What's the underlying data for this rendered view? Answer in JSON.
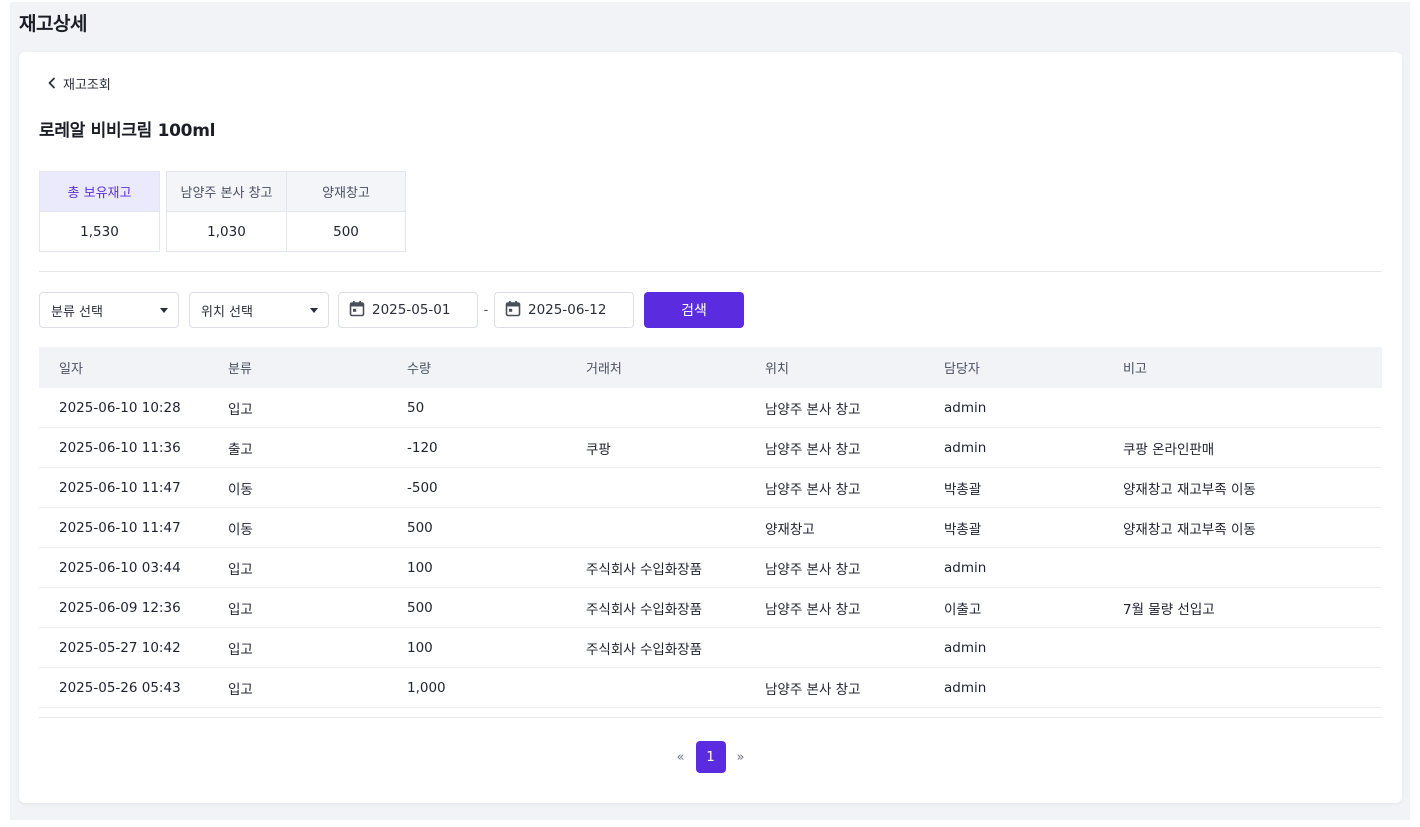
{
  "page": {
    "title": "재고상세"
  },
  "back": {
    "label": "재고조회"
  },
  "product": {
    "name": "로레알 비비크림 100ml"
  },
  "stock": {
    "total": {
      "label": "총 보유재고",
      "value": "1,530"
    },
    "locations": [
      {
        "label": "남양주 본사 창고",
        "value": "1,030"
      },
      {
        "label": "양재창고",
        "value": "500"
      }
    ]
  },
  "filters": {
    "category_placeholder": "분류 선택",
    "location_placeholder": "위치 선택",
    "date_from": "2025-05-01",
    "date_separator": "-",
    "date_to": "2025-06-12",
    "search_label": "검색"
  },
  "table": {
    "headers": [
      "일자",
      "분류",
      "수량",
      "거래처",
      "위치",
      "담당자",
      "비고"
    ],
    "rows": [
      [
        "2025-06-10 10:28",
        "입고",
        "50",
        "",
        "남양주 본사 창고",
        "admin",
        ""
      ],
      [
        "2025-06-10 11:36",
        "출고",
        "-120",
        "쿠팡",
        "남양주 본사 창고",
        "admin",
        "쿠팡 온라인판매"
      ],
      [
        "2025-06-10 11:47",
        "이동",
        "-500",
        "",
        "남양주 본사 창고",
        "박총괄",
        "양재창고 재고부족 이동"
      ],
      [
        "2025-06-10 11:47",
        "이동",
        "500",
        "",
        "양재창고",
        "박총괄",
        "양재창고 재고부족 이동"
      ],
      [
        "2025-06-10 03:44",
        "입고",
        "100",
        "주식회사 수입화장품",
        "남양주 본사 창고",
        "admin",
        ""
      ],
      [
        "2025-06-09 12:36",
        "입고",
        "500",
        "주식회사 수입화장품",
        "남양주 본사 창고",
        "이출고",
        "7월 물량 선입고"
      ],
      [
        "2025-05-27 10:42",
        "입고",
        "100",
        "주식회사 수입화장품",
        "",
        "admin",
        ""
      ],
      [
        "2025-05-26 05:43",
        "입고",
        "1,000",
        "",
        "남양주 본사 창고",
        "admin",
        ""
      ]
    ]
  },
  "pagination": {
    "prev": "«",
    "current": "1",
    "next": "»"
  },
  "colors": {
    "accent": "#5b2be0",
    "background": "#f1f3f7",
    "total_header": "#eaeafc"
  }
}
